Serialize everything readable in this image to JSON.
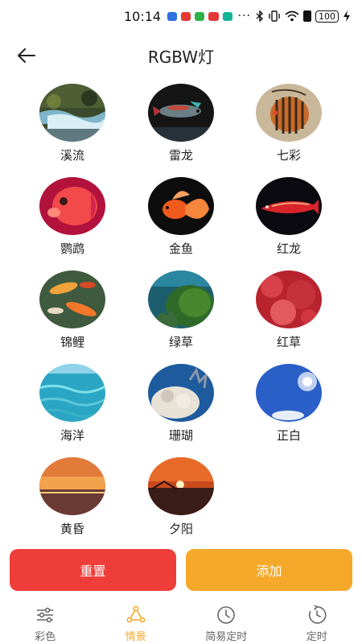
{
  "status_bar": {
    "time": "10:14",
    "more": "···",
    "battery": "100",
    "notification_colors": [
      "#2f6fe0",
      "#e53935",
      "#2eb34a",
      "#e53935",
      "#13b59a"
    ]
  },
  "header": {
    "title": "RGBW灯"
  },
  "scenes": [
    {
      "label": "溪流",
      "icon": "stream-image"
    },
    {
      "label": "雷龙",
      "icon": "fish-image"
    },
    {
      "label": "七彩",
      "icon": "discus-image"
    },
    {
      "label": "鹦鹉",
      "icon": "parrot-fish-image"
    },
    {
      "label": "金鱼",
      "icon": "goldfish-image"
    },
    {
      "label": "红龙",
      "icon": "red-arowana-image"
    },
    {
      "label": "锦鲤",
      "icon": "koi-image"
    },
    {
      "label": "绿草",
      "icon": "green-grass-image"
    },
    {
      "label": "红草",
      "icon": "red-grass-image"
    },
    {
      "label": "海洋",
      "icon": "ocean-image"
    },
    {
      "label": "珊瑚",
      "icon": "coral-image"
    },
    {
      "label": "正白",
      "icon": "sun-sky-image"
    },
    {
      "label": "黄昏",
      "icon": "dusk-image"
    },
    {
      "label": "夕阳",
      "icon": "sunset-image"
    }
  ],
  "actions": {
    "reset_label": "重置",
    "add_label": "添加",
    "reset_color": "#ef3e3a",
    "add_color": "#f5a82a"
  },
  "bottom_nav": {
    "active_color": "#f5a82a",
    "items": [
      {
        "label": "彩色",
        "icon": "sliders-icon",
        "active": false
      },
      {
        "label": "情景",
        "icon": "scene-icon",
        "active": true
      },
      {
        "label": "简易定时",
        "icon": "clock-icon",
        "active": false
      },
      {
        "label": "定时",
        "icon": "timer-icon",
        "active": false
      }
    ]
  }
}
